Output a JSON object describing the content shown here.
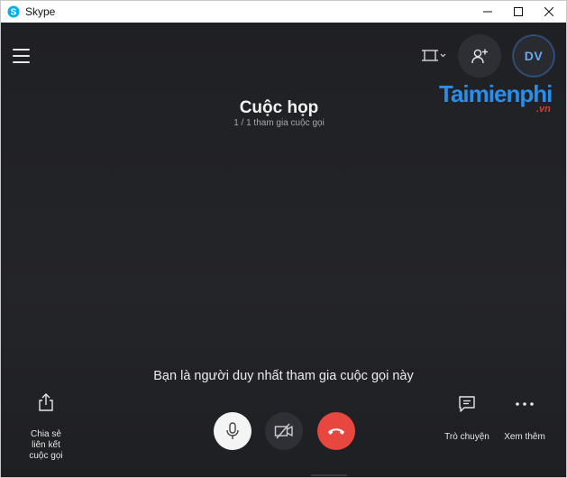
{
  "window": {
    "title": "Skype",
    "accent": "#00aff0"
  },
  "header": {
    "avatar_initials": "DV",
    "layout_icon": "layout-grid-icon",
    "add_people_icon": "add-person-icon"
  },
  "watermark": {
    "brand": "Taimienphi",
    "suffix": ".vn"
  },
  "call": {
    "title": "Cuộc họp",
    "participants": "1 / 1 tham gia cuộc gọi",
    "alone_message": "Bạn là người duy nhất tham gia cuộc gọi này"
  },
  "actions": {
    "share_label_lines": [
      "Chia sẻ",
      "liên kết",
      "cuộc gọi"
    ],
    "chat_label": "Trò chuyện",
    "more_label": "Xem thêm"
  },
  "controls": {
    "mic_icon": "microphone-icon",
    "video_icon": "video-off-icon",
    "hangup_icon": "hang-up-icon",
    "hangup_color": "#e8473f"
  }
}
